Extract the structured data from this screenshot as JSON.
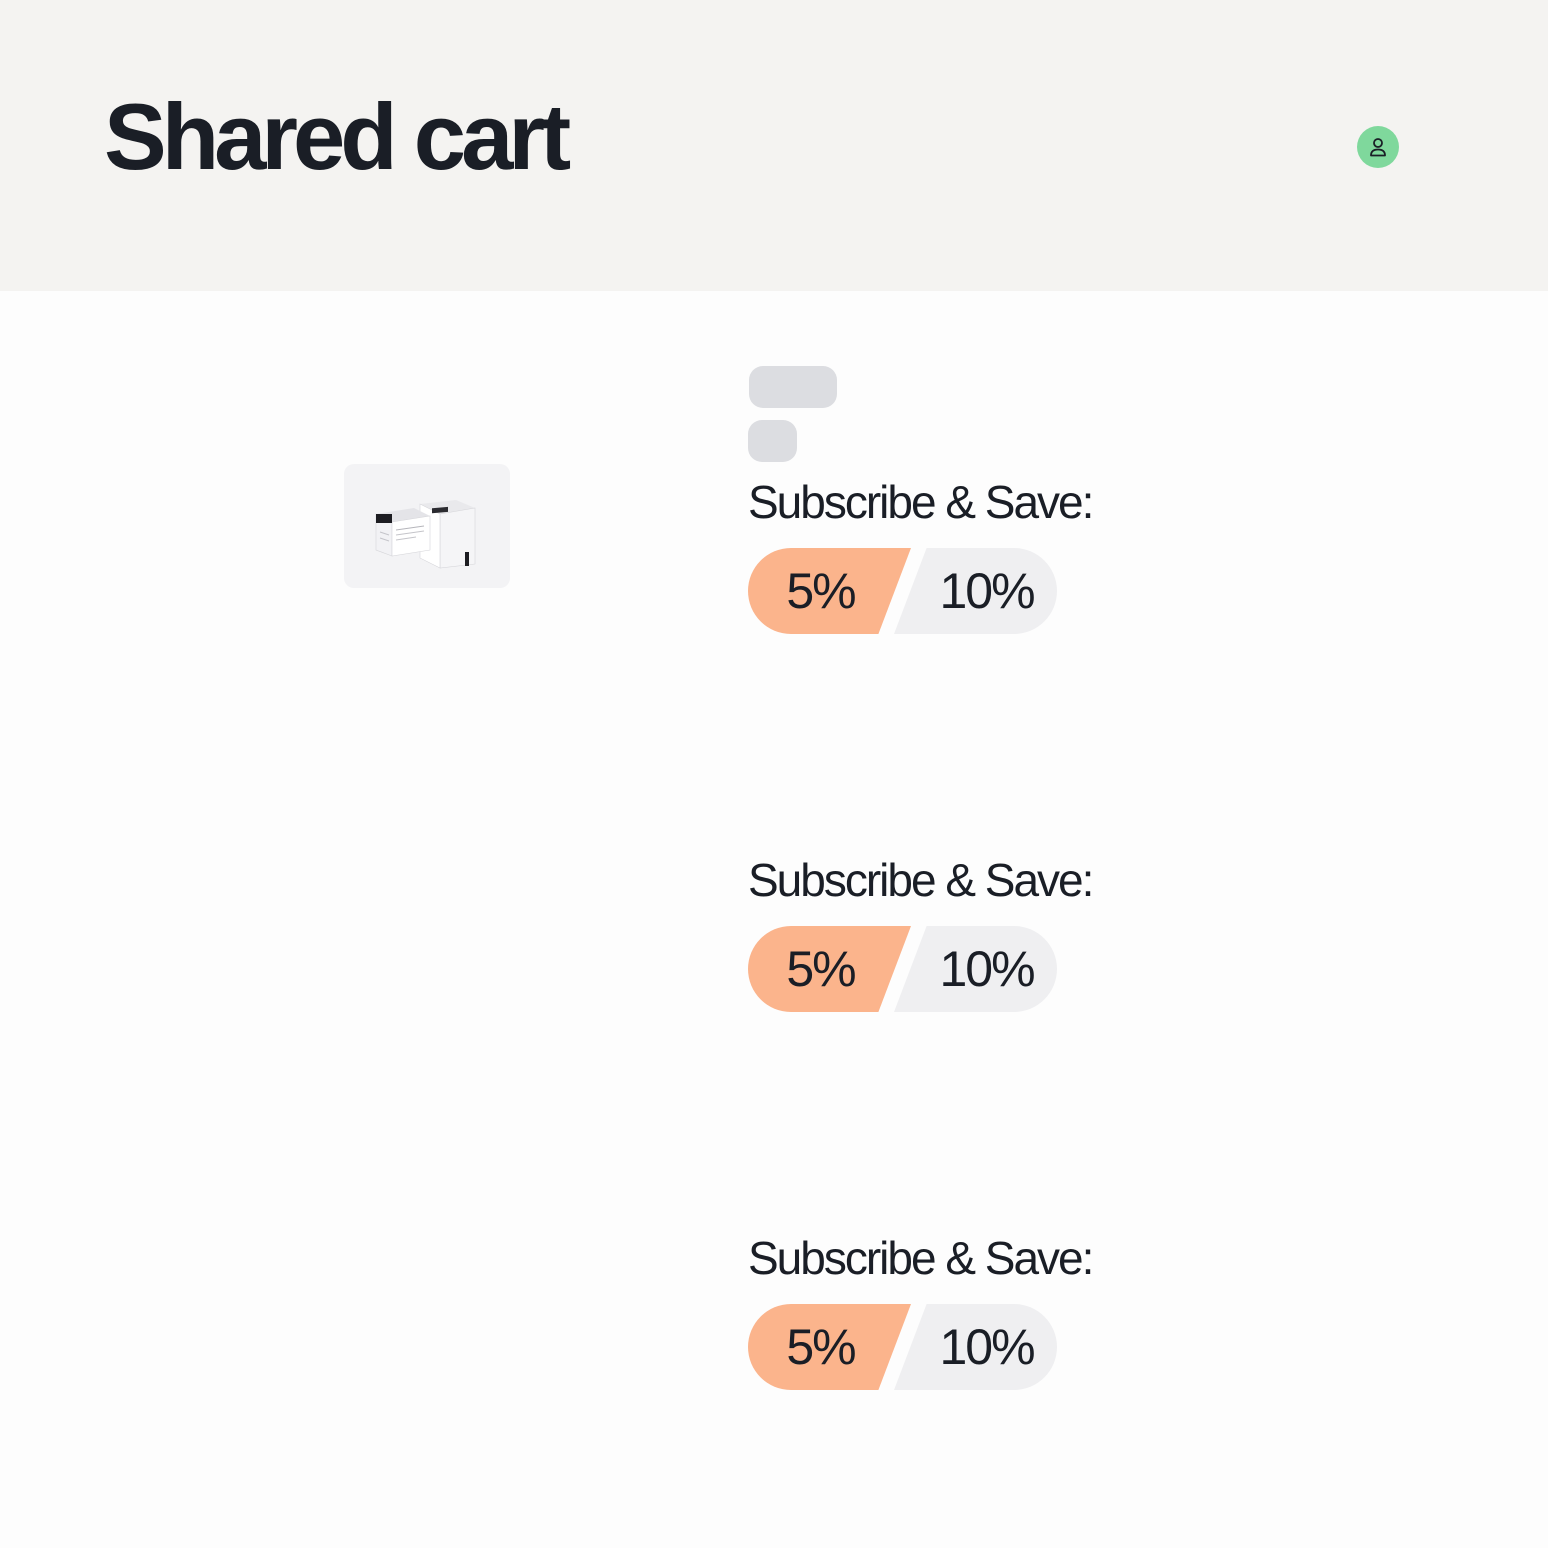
{
  "header": {
    "title": "Shared cart",
    "avatar_icon": "user-icon"
  },
  "colors": {
    "header_bg": "#f4f3f1",
    "avatar_bg": "#7fd89c",
    "active_segment": "#fbb48c",
    "inactive_segment": "#efeff1",
    "skeleton": "#dcdde1"
  },
  "items": [
    {
      "subscribe_label": "Subscribe & Save:",
      "options": [
        "5%",
        "10%"
      ],
      "selected": "5%"
    },
    {
      "subscribe_label": "Subscribe & Save:",
      "options": [
        "5%",
        "10%"
      ],
      "selected": "5%"
    },
    {
      "subscribe_label": "Subscribe & Save:",
      "options": [
        "5%",
        "10%"
      ],
      "selected": "5%"
    }
  ]
}
